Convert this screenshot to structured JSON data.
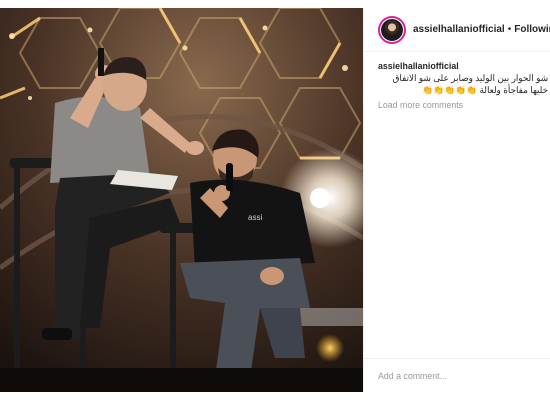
{
  "post": {
    "username": "assielhallaniofficial",
    "separator": "•",
    "follow_status": "Following",
    "caption_user": "assielhallaniofficial",
    "caption_text": "شو الحوار بين الوليد وصابر على شو الاتفاق خليها مفاجأة ولعالة 👏👏👏👏👏",
    "load_more": "Load more comments",
    "comment_placeholder": "Add a comment..."
  },
  "media": {
    "description_icon": "photo",
    "shirt_text": "assi"
  }
}
